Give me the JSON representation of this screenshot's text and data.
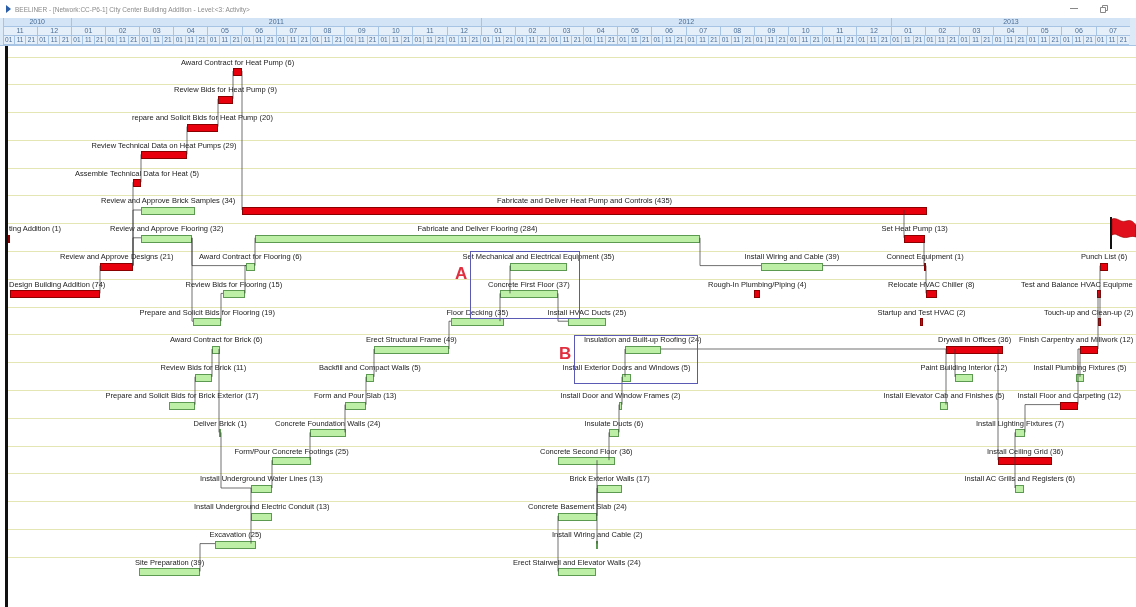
{
  "window": {
    "title": "BEELINER - [Network:CC-P6-1] City Center Building Addition - Level:<3: Activity>"
  },
  "timescale": {
    "years": [
      {
        "label": "2010",
        "months": [
          {
            "label": "11",
            "days": [
              "01",
              "11",
              "21"
            ]
          },
          {
            "label": "12",
            "days": [
              "01",
              "11",
              "21"
            ]
          }
        ]
      },
      {
        "label": "2011",
        "months": [
          {
            "label": "01",
            "days": [
              "01",
              "11",
              "21"
            ]
          },
          {
            "label": "02",
            "days": [
              "01",
              "11",
              "21"
            ]
          },
          {
            "label": "03",
            "days": [
              "01",
              "11",
              "21"
            ]
          },
          {
            "label": "04",
            "days": [
              "01",
              "11",
              "21"
            ]
          },
          {
            "label": "05",
            "days": [
              "01",
              "11",
              "21"
            ]
          },
          {
            "label": "06",
            "days": [
              "01",
              "11",
              "21"
            ]
          },
          {
            "label": "07",
            "days": [
              "01",
              "11",
              "21"
            ]
          },
          {
            "label": "08",
            "days": [
              "01",
              "11",
              "21"
            ]
          },
          {
            "label": "09",
            "days": [
              "01",
              "11",
              "21"
            ]
          },
          {
            "label": "10",
            "days": [
              "01",
              "11",
              "21"
            ]
          },
          {
            "label": "11",
            "days": [
              "01",
              "11",
              "21"
            ]
          },
          {
            "label": "12",
            "days": [
              "01",
              "11",
              "21"
            ]
          }
        ]
      },
      {
        "label": "2012",
        "months": [
          {
            "label": "01",
            "days": [
              "01",
              "11",
              "21"
            ]
          },
          {
            "label": "02",
            "days": [
              "01",
              "11",
              "21"
            ]
          },
          {
            "label": "03",
            "days": [
              "01",
              "11",
              "21"
            ]
          },
          {
            "label": "04",
            "days": [
              "01",
              "11",
              "21"
            ]
          },
          {
            "label": "05",
            "days": [
              "01",
              "11",
              "21"
            ]
          },
          {
            "label": "06",
            "days": [
              "01",
              "11",
              "21"
            ]
          },
          {
            "label": "07",
            "days": [
              "01",
              "11",
              "21"
            ]
          },
          {
            "label": "08",
            "days": [
              "01",
              "11",
              "21"
            ]
          },
          {
            "label": "09",
            "days": [
              "01",
              "11",
              "21"
            ]
          },
          {
            "label": "10",
            "days": [
              "01",
              "11",
              "21"
            ]
          },
          {
            "label": "11",
            "days": [
              "01",
              "11",
              "21"
            ]
          },
          {
            "label": "12",
            "days": [
              "01",
              "11",
              "21"
            ]
          }
        ]
      },
      {
        "label": "2013",
        "months": [
          {
            "label": "01",
            "days": [
              "01",
              "11",
              "21"
            ]
          },
          {
            "label": "02",
            "days": [
              "01",
              "11",
              "21"
            ]
          },
          {
            "label": "03",
            "days": [
              "01",
              "11",
              "21"
            ]
          },
          {
            "label": "04",
            "days": [
              "01",
              "11",
              "21"
            ]
          },
          {
            "label": "05",
            "days": [
              "01",
              "11",
              "21"
            ]
          },
          {
            "label": "06",
            "days": [
              "01",
              "11",
              "21"
            ]
          },
          {
            "label": "07",
            "days": [
              "01",
              "11",
              "21"
            ]
          }
        ]
      }
    ]
  },
  "chart": {
    "rows": [
      {
        "activities": [
          {
            "label": "Award Contract for Heat Pump (6)",
            "critical": true
          }
        ]
      },
      {
        "activities": [
          {
            "label": "Review Bids for Heat Pump (9)",
            "critical": true
          }
        ]
      },
      {
        "activities": [
          {
            "label": "repare and Solicit Bids for Heat Pump (20)",
            "critical": true
          }
        ]
      },
      {
        "activities": [
          {
            "label": "Review Technical Data on Heat Pumps (29)",
            "critical": true
          }
        ]
      },
      {
        "activities": [
          {
            "label": "Assemble Technical Data for Heat (5)",
            "critical": true
          }
        ]
      },
      {
        "activities": [
          {
            "label": "Review and Approve Brick Samples (34)",
            "critical": false
          },
          {
            "label": "Fabricate and Deliver Heat Pump and Controls (435)",
            "critical": true
          }
        ]
      },
      {
        "activities": [
          {
            "label": "ting Addition (1)",
            "critical": true
          },
          {
            "label": "Review and Approve Flooring (32)",
            "critical": false
          },
          {
            "label": "Fabricate and Deliver Flooring (284)",
            "critical": false
          },
          {
            "label": "Set Heat Pump (13)",
            "critical": true
          }
        ]
      },
      {
        "activities": [
          {
            "label": "Review and Approve Designs (21)",
            "critical": true
          },
          {
            "label": "Award Contract for Flooring (6)",
            "critical": false
          },
          {
            "label": "Set Mechanical and Electrical Equipment (35)",
            "critical": false
          },
          {
            "label": "Install Wiring and Cable (39)",
            "critical": false
          },
          {
            "label": "Connect Equipment (1)",
            "critical": true
          },
          {
            "label": "Punch List (6)",
            "critical": true
          }
        ]
      },
      {
        "activities": [
          {
            "label": "Design Building Addition (74)",
            "critical": true
          },
          {
            "label": "Review Bids for Flooring (15)",
            "critical": false
          },
          {
            "label": "Concrete First Floor (37)",
            "critical": false
          },
          {
            "label": "Rough-In Plumbing/Piping (4)",
            "critical": true
          },
          {
            "label": "Relocate HVAC Chiller (8)",
            "critical": true
          },
          {
            "label": "Test and Balance HVAC Equipme",
            "critical": true
          }
        ]
      },
      {
        "activities": [
          {
            "label": "Prepare and Solicit Bids for Flooring (19)",
            "critical": false
          },
          {
            "label": "Floor Decking (35)",
            "critical": false
          },
          {
            "label": "Install HVAC Ducts (25)",
            "critical": false
          },
          {
            "label": "Startup and Test HVAC (2)",
            "critical": true
          },
          {
            "label": "Touch-up and Clean-up (2)",
            "critical": true
          }
        ]
      },
      {
        "activities": [
          {
            "label": "Award Contract for Brick (6)",
            "critical": false
          },
          {
            "label": "Erect Structural Frame (49)",
            "critical": false
          },
          {
            "label": "Insulation and Built-up Roofing (24)",
            "critical": false
          },
          {
            "label": "Drywall in Offices (36)",
            "critical": true
          },
          {
            "label": "Finish Carpentry and Millwork (12)",
            "critical": true
          }
        ]
      },
      {
        "activities": [
          {
            "label": "Review Bids for Brick (11)",
            "critical": false
          },
          {
            "label": "Backfill and Compact Walls (5)",
            "critical": false
          },
          {
            "label": "Install Exterior Doors and Windows (5)",
            "critical": false
          },
          {
            "label": "Paint Building Interior (12)",
            "critical": false
          },
          {
            "label": "Install Plumbing Fixtures (5)",
            "critical": false
          }
        ]
      },
      {
        "activities": [
          {
            "label": "Prepare and Solicit Bids for Brick Exterior (17)",
            "critical": false
          },
          {
            "label": "Form and Pour Slab (13)",
            "critical": false
          },
          {
            "label": "Install Door and Window Frames (2)",
            "critical": false
          },
          {
            "label": "Install Elevator Cab and Finishes (5)",
            "critical": false
          },
          {
            "label": "Install Floor and Carpeting (12)",
            "critical": true
          }
        ]
      },
      {
        "activities": [
          {
            "label": "Deliver Brick (1)",
            "critical": false
          },
          {
            "label": "Concrete Foundation Walls (24)",
            "critical": false
          },
          {
            "label": "Insulate Ducts (6)",
            "critical": false
          },
          {
            "label": "Install Lighting Fixtures (7)",
            "critical": false
          }
        ]
      },
      {
        "activities": [
          {
            "label": "Form/Pour Concrete Footings (25)",
            "critical": false
          },
          {
            "label": "Concrete Second Floor (36)",
            "critical": false
          },
          {
            "label": "Install Ceiling Grid (36)",
            "critical": true
          }
        ]
      },
      {
        "activities": [
          {
            "label": "Install Underground Water Lines (13)",
            "critical": false
          },
          {
            "label": "Brick Exterior Walls (17)",
            "critical": false
          },
          {
            "label": "Install AC Grills and Registers (6)",
            "critical": false
          }
        ]
      },
      {
        "activities": [
          {
            "label": "Install Underground Electric Conduit (13)",
            "critical": false
          },
          {
            "label": "Concrete Basement Slab (24)",
            "critical": false
          }
        ]
      },
      {
        "activities": [
          {
            "label": "Excavation (25)",
            "critical": false
          },
          {
            "label": "Install Wiring and Cable (2)",
            "critical": false
          }
        ]
      },
      {
        "activities": [
          {
            "label": "Site Preparation (39)",
            "critical": false
          },
          {
            "label": "Erect Stairwell and Elevator Walls (24)",
            "critical": false
          }
        ]
      }
    ],
    "annotations": [
      {
        "label": "A"
      },
      {
        "label": "B"
      }
    ]
  }
}
